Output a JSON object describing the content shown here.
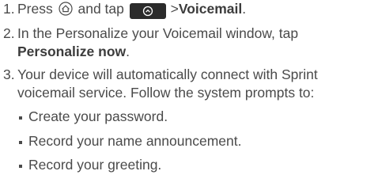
{
  "steps": [
    {
      "number": "1.",
      "text_before": "Press",
      "home_icon": "home-key-icon",
      "text_middle": "and tap",
      "apps_icon": "applications-button-icon",
      "text_after_prefix": ">",
      "target": "Voicemail",
      "text_end": "."
    },
    {
      "number": "2.",
      "line1": "In the Personalize your Voicemail window, tap",
      "target": "Personalize now",
      "text_end": "."
    },
    {
      "number": "3.",
      "line1": "Your device will automatically connect with Sprint",
      "line2": "voicemail service. Follow the system prompts to:"
    }
  ],
  "bullets": [
    "Create your password.",
    "Record your name announcement.",
    "Record your greeting."
  ],
  "colors": {
    "text": "#4a4a4a",
    "button_bg": "#2b2b2b"
  }
}
